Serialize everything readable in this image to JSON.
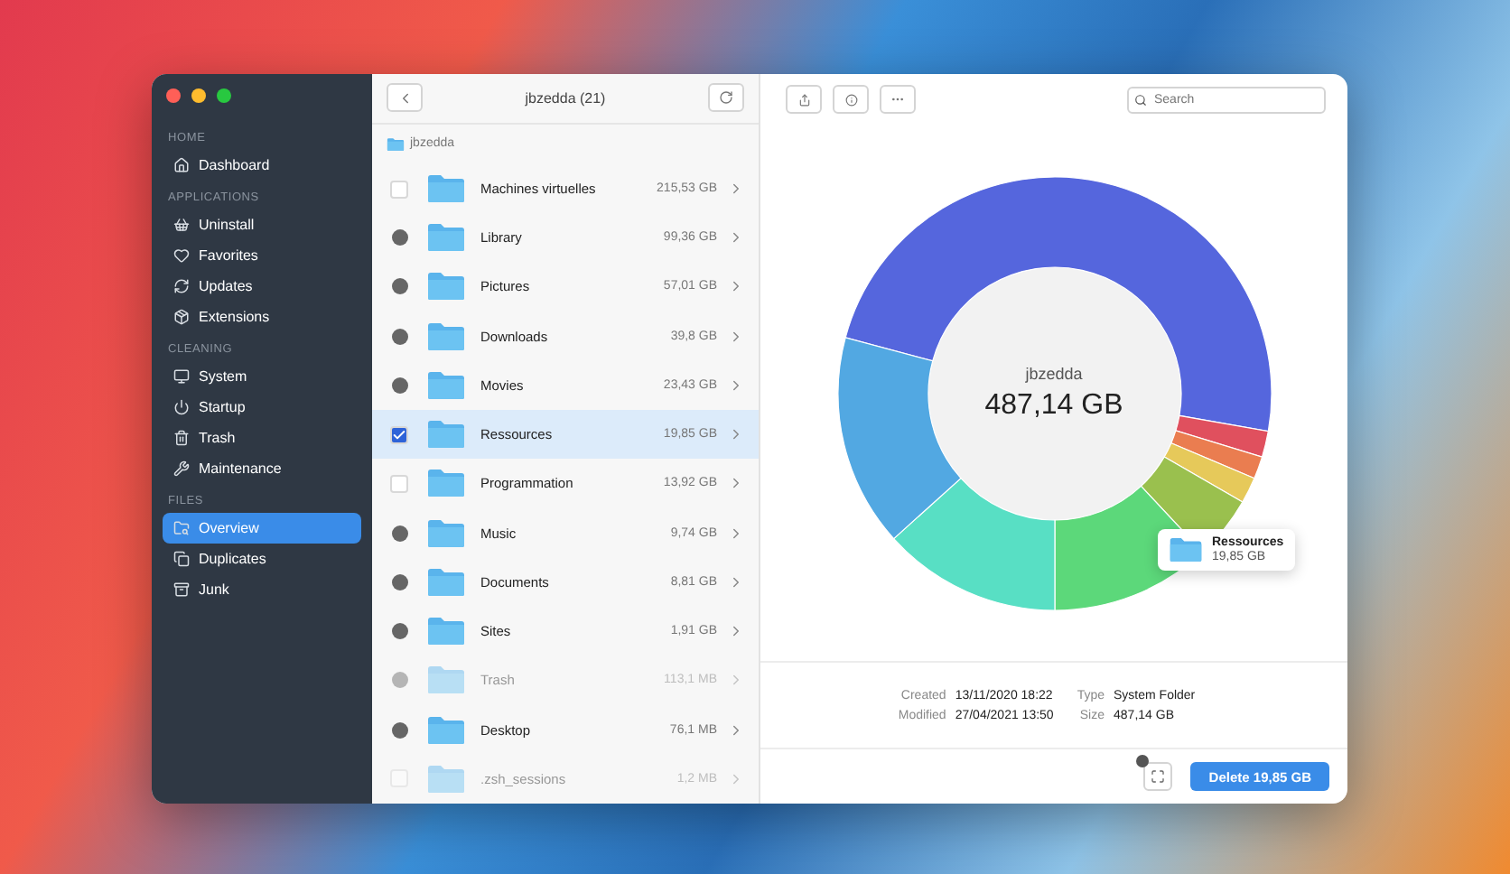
{
  "sidebar": {
    "sections": [
      {
        "title": "HOME",
        "items": [
          {
            "label": "Dashboard",
            "selected": false
          }
        ]
      },
      {
        "title": "APPLICATIONS",
        "items": [
          {
            "label": "Uninstall",
            "selected": false
          },
          {
            "label": "Favorites",
            "selected": false
          },
          {
            "label": "Updates",
            "selected": false
          },
          {
            "label": "Extensions",
            "selected": false
          }
        ]
      },
      {
        "title": "CLEANING",
        "items": [
          {
            "label": "System",
            "selected": false
          },
          {
            "label": "Startup",
            "selected": false
          },
          {
            "label": "Trash",
            "selected": false
          },
          {
            "label": "Maintenance",
            "selected": false
          }
        ]
      },
      {
        "title": "FILES",
        "items": [
          {
            "label": "Overview",
            "selected": true
          },
          {
            "label": "Duplicates",
            "selected": false
          },
          {
            "label": "Junk",
            "selected": false
          }
        ]
      }
    ]
  },
  "browser": {
    "title": "jbzedda (21)",
    "path": "jbzedda",
    "rows": [
      {
        "name": "Machines virtuelles",
        "size": "215,53 GB",
        "kind": "checkbox",
        "checked": false,
        "selected": false,
        "dimmed": false
      },
      {
        "name": "Library",
        "size": "99,36 GB",
        "kind": "info",
        "selected": false,
        "dimmed": false
      },
      {
        "name": "Pictures",
        "size": "57,01 GB",
        "kind": "info",
        "selected": false,
        "dimmed": false
      },
      {
        "name": "Downloads",
        "size": "39,8 GB",
        "kind": "info",
        "selected": false,
        "dimmed": false
      },
      {
        "name": "Movies",
        "size": "23,43 GB",
        "kind": "info",
        "selected": false,
        "dimmed": false
      },
      {
        "name": "Ressources",
        "size": "19,85 GB",
        "kind": "checkbox",
        "checked": true,
        "selected": true,
        "dimmed": false
      },
      {
        "name": "Programmation",
        "size": "13,92 GB",
        "kind": "checkbox",
        "checked": false,
        "selected": false,
        "dimmed": false
      },
      {
        "name": "Music",
        "size": "9,74 GB",
        "kind": "info",
        "selected": false,
        "dimmed": false
      },
      {
        "name": "Documents",
        "size": "8,81 GB",
        "kind": "info",
        "selected": false,
        "dimmed": false
      },
      {
        "name": "Sites",
        "size": "1,91 GB",
        "kind": "info",
        "selected": false,
        "dimmed": false
      },
      {
        "name": "Trash",
        "size": "113,1 MB",
        "kind": "info",
        "selected": false,
        "dimmed": true
      },
      {
        "name": "Desktop",
        "size": "76,1 MB",
        "kind": "info",
        "selected": false,
        "dimmed": false
      },
      {
        "name": ".zsh_sessions",
        "size": "1,2 MB",
        "kind": "checkbox",
        "checked": false,
        "selected": false,
        "dimmed": true
      }
    ]
  },
  "detail": {
    "search": {
      "placeholder": "Search"
    },
    "donut": {
      "name": "jbzedda",
      "total": "487,14 GB"
    },
    "tooltip": {
      "name": "Ressources",
      "size": "19,85 GB"
    },
    "info": [
      {
        "label": "Created",
        "value": "13/11/2020 18:22"
      },
      {
        "label": "Type",
        "value": "System Folder"
      },
      {
        "label": "Modified",
        "value": "27/04/2021 13:50"
      },
      {
        "label": "Size",
        "value": "487,14 GB"
      }
    ],
    "delete_button": "Delete 19,85 GB"
  }
}
